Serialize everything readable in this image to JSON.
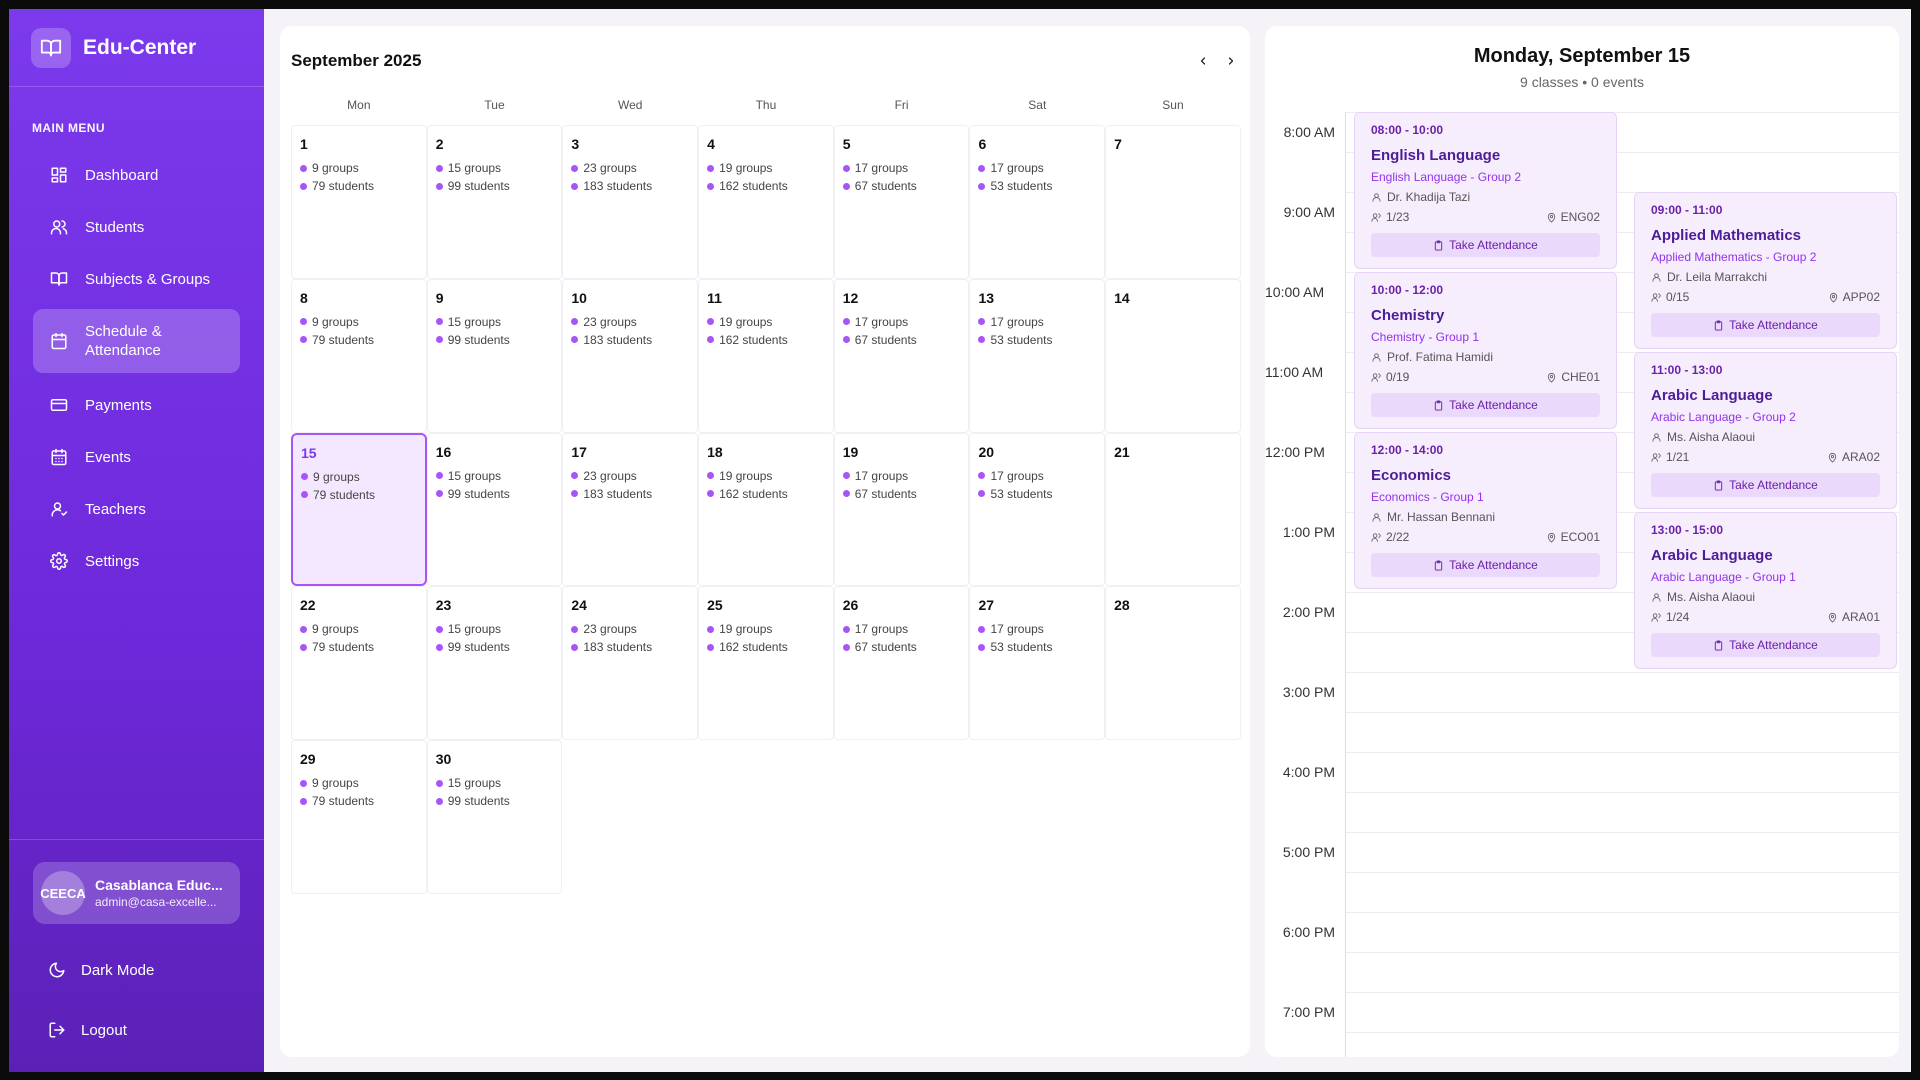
{
  "brand": {
    "name": "Edu-Center"
  },
  "sidebar": {
    "menu_title": "MAIN MENU",
    "items": [
      {
        "label": "Dashboard",
        "icon": "dashboard-icon"
      },
      {
        "label": "Students",
        "icon": "users-icon"
      },
      {
        "label": "Subjects & Groups",
        "icon": "book-icon"
      },
      {
        "label": "Schedule & Attendance",
        "icon": "calendar-icon",
        "active": true
      },
      {
        "label": "Payments",
        "icon": "credit-card-icon"
      },
      {
        "label": "Events",
        "icon": "calendar-days-icon"
      },
      {
        "label": "Teachers",
        "icon": "teacher-icon"
      },
      {
        "label": "Settings",
        "icon": "gear-icon"
      }
    ],
    "user": {
      "initials": "CEECA",
      "name": "Casablanca Educ...",
      "email": "admin@casa-excelle..."
    },
    "dark_mode_label": "Dark Mode",
    "logout_label": "Logout"
  },
  "calendar": {
    "title": "September 2025",
    "weekdays": [
      "Mon",
      "Tue",
      "Wed",
      "Thu",
      "Fri",
      "Sat",
      "Sun"
    ],
    "selected_day": 15,
    "days": [
      {
        "day": "1",
        "groups": "9 groups",
        "students": "79 students"
      },
      {
        "day": "2",
        "groups": "15 groups",
        "students": "99 students"
      },
      {
        "day": "3",
        "groups": "23 groups",
        "students": "183 students"
      },
      {
        "day": "4",
        "groups": "19 groups",
        "students": "162 students"
      },
      {
        "day": "5",
        "groups": "17 groups",
        "students": "67 students"
      },
      {
        "day": "6",
        "groups": "17 groups",
        "students": "53 students"
      },
      {
        "day": "7"
      },
      {
        "day": "8",
        "groups": "9 groups",
        "students": "79 students"
      },
      {
        "day": "9",
        "groups": "15 groups",
        "students": "99 students"
      },
      {
        "day": "10",
        "groups": "23 groups",
        "students": "183 students"
      },
      {
        "day": "11",
        "groups": "19 groups",
        "students": "162 students"
      },
      {
        "day": "12",
        "groups": "17 groups",
        "students": "67 students"
      },
      {
        "day": "13",
        "groups": "17 groups",
        "students": "53 students"
      },
      {
        "day": "14"
      },
      {
        "day": "15",
        "groups": "9 groups",
        "students": "79 students"
      },
      {
        "day": "16",
        "groups": "15 groups",
        "students": "99 students"
      },
      {
        "day": "17",
        "groups": "23 groups",
        "students": "183 students"
      },
      {
        "day": "18",
        "groups": "19 groups",
        "students": "162 students"
      },
      {
        "day": "19",
        "groups": "17 groups",
        "students": "67 students"
      },
      {
        "day": "20",
        "groups": "17 groups",
        "students": "53 students"
      },
      {
        "day": "21"
      },
      {
        "day": "22",
        "groups": "9 groups",
        "students": "79 students"
      },
      {
        "day": "23",
        "groups": "15 groups",
        "students": "99 students"
      },
      {
        "day": "24",
        "groups": "23 groups",
        "students": "183 students"
      },
      {
        "day": "25",
        "groups": "19 groups",
        "students": "162 students"
      },
      {
        "day": "26",
        "groups": "17 groups",
        "students": "67 students"
      },
      {
        "day": "27",
        "groups": "17 groups",
        "students": "53 students"
      },
      {
        "day": "28"
      },
      {
        "day": "29",
        "groups": "9 groups",
        "students": "79 students"
      },
      {
        "day": "30",
        "groups": "15 groups",
        "students": "99 students"
      }
    ]
  },
  "day_view": {
    "title": "Monday, September 15",
    "subtitle": "9 classes • 0 events",
    "hours": [
      "8:00 AM",
      "9:00 AM",
      "10:00 AM",
      "11:00 AM",
      "12:00 PM",
      "1:00 PM",
      "2:00 PM",
      "3:00 PM",
      "4:00 PM",
      "5:00 PM",
      "6:00 PM",
      "7:00 PM"
    ],
    "events": [
      {
        "time": "08:00 - 10:00",
        "title": "English Language",
        "group": "English Language - Group 2",
        "teacher": "Dr. Khadija Tazi",
        "attendance": "1/23",
        "room": "ENG02",
        "button": "Take Attendance",
        "start": 8,
        "column": 0
      },
      {
        "time": "10:00 - 12:00",
        "title": "Chemistry",
        "group": "Chemistry - Group 1",
        "teacher": "Prof. Fatima Hamidi",
        "attendance": "0/19",
        "room": "CHE01",
        "button": "Take Attendance",
        "start": 10,
        "column": 0
      },
      {
        "time": "12:00 - 14:00",
        "title": "Economics",
        "group": "Economics - Group 1",
        "teacher": "Mr. Hassan Bennani",
        "attendance": "2/22",
        "room": "ECO01",
        "button": "Take Attendance",
        "start": 12,
        "column": 0
      },
      {
        "time": "09:00 - 11:00",
        "title": "Applied Mathematics",
        "group": "Applied Mathematics - Group 2",
        "teacher": "Dr. Leila Marrakchi",
        "attendance": "0/15",
        "room": "APP02",
        "button": "Take Attendance",
        "start": 9,
        "column": 1
      },
      {
        "time": "11:00 - 13:00",
        "title": "Arabic Language",
        "group": "Arabic Language - Group 2",
        "teacher": "Ms. Aisha Alaoui",
        "attendance": "1/21",
        "room": "ARA02",
        "button": "Take Attendance",
        "start": 11,
        "column": 1
      },
      {
        "time": "13:00 - 15:00",
        "title": "Arabic Language",
        "group": "Arabic Language - Group 1",
        "teacher": "Ms. Aisha Alaoui",
        "attendance": "1/24",
        "room": "ARA01",
        "button": "Take Attendance",
        "start": 13,
        "column": 1
      }
    ]
  },
  "colors": {
    "sidebar": "#7c3aed",
    "accent": "#a855f7",
    "today_bg": "#f3e8ff"
  }
}
